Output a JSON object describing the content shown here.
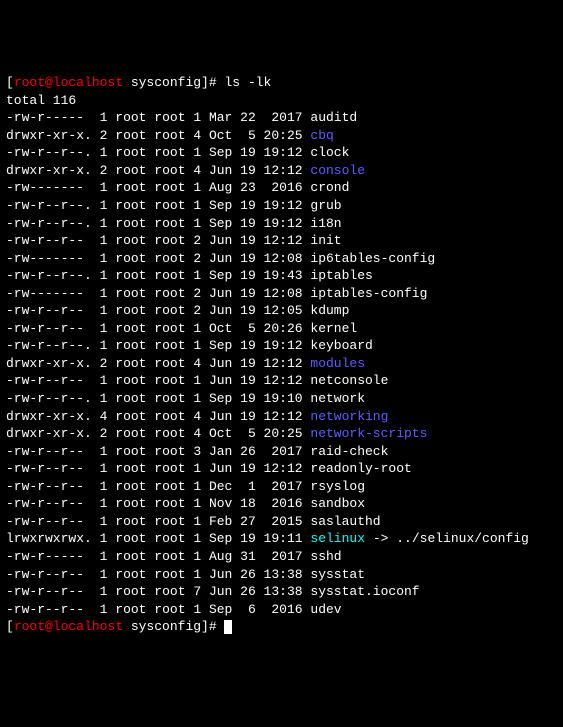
{
  "prompt": {
    "user": "root",
    "host": "localhost",
    "cwd": "sysconfig",
    "symbol": "#"
  },
  "command": "ls -lk",
  "total_line": "total 116",
  "rows": [
    {
      "perm": "-rw-r-----",
      "links": "1",
      "own": "root",
      "grp": "root",
      "size": "1",
      "date": "Mar 22  2017",
      "name": "auditd",
      "type": "file"
    },
    {
      "perm": "drwxr-xr-x.",
      "links": "2",
      "own": "root",
      "grp": "root",
      "size": "4",
      "date": "Oct  5 20:25",
      "name": "cbq",
      "type": "dir"
    },
    {
      "perm": "-rw-r--r--.",
      "links": "1",
      "own": "root",
      "grp": "root",
      "size": "1",
      "date": "Sep 19 19:12",
      "name": "clock",
      "type": "file"
    },
    {
      "perm": "drwxr-xr-x.",
      "links": "2",
      "own": "root",
      "grp": "root",
      "size": "4",
      "date": "Jun 19 12:12",
      "name": "console",
      "type": "dir"
    },
    {
      "perm": "-rw-------",
      "links": "1",
      "own": "root",
      "grp": "root",
      "size": "1",
      "date": "Aug 23  2016",
      "name": "crond",
      "type": "file"
    },
    {
      "perm": "-rw-r--r--.",
      "links": "1",
      "own": "root",
      "grp": "root",
      "size": "1",
      "date": "Sep 19 19:12",
      "name": "grub",
      "type": "file"
    },
    {
      "perm": "-rw-r--r--.",
      "links": "1",
      "own": "root",
      "grp": "root",
      "size": "1",
      "date": "Sep 19 19:12",
      "name": "i18n",
      "type": "file"
    },
    {
      "perm": "-rw-r--r--",
      "links": "1",
      "own": "root",
      "grp": "root",
      "size": "2",
      "date": "Jun 19 12:12",
      "name": "init",
      "type": "file"
    },
    {
      "perm": "-rw-------",
      "links": "1",
      "own": "root",
      "grp": "root",
      "size": "2",
      "date": "Jun 19 12:08",
      "name": "ip6tables-config",
      "type": "file"
    },
    {
      "perm": "-rw-r--r--.",
      "links": "1",
      "own": "root",
      "grp": "root",
      "size": "1",
      "date": "Sep 19 19:43",
      "name": "iptables",
      "type": "file"
    },
    {
      "perm": "-rw-------",
      "links": "1",
      "own": "root",
      "grp": "root",
      "size": "2",
      "date": "Jun 19 12:08",
      "name": "iptables-config",
      "type": "file"
    },
    {
      "perm": "-rw-r--r--",
      "links": "1",
      "own": "root",
      "grp": "root",
      "size": "2",
      "date": "Jun 19 12:05",
      "name": "kdump",
      "type": "file"
    },
    {
      "perm": "-rw-r--r--",
      "links": "1",
      "own": "root",
      "grp": "root",
      "size": "1",
      "date": "Oct  5 20:26",
      "name": "kernel",
      "type": "file"
    },
    {
      "perm": "-rw-r--r--.",
      "links": "1",
      "own": "root",
      "grp": "root",
      "size": "1",
      "date": "Sep 19 19:12",
      "name": "keyboard",
      "type": "file"
    },
    {
      "perm": "drwxr-xr-x.",
      "links": "2",
      "own": "root",
      "grp": "root",
      "size": "4",
      "date": "Jun 19 12:12",
      "name": "modules",
      "type": "dir"
    },
    {
      "perm": "-rw-r--r--",
      "links": "1",
      "own": "root",
      "grp": "root",
      "size": "1",
      "date": "Jun 19 12:12",
      "name": "netconsole",
      "type": "file"
    },
    {
      "perm": "-rw-r--r--.",
      "links": "1",
      "own": "root",
      "grp": "root",
      "size": "1",
      "date": "Sep 19 19:10",
      "name": "network",
      "type": "file"
    },
    {
      "perm": "drwxr-xr-x.",
      "links": "4",
      "own": "root",
      "grp": "root",
      "size": "4",
      "date": "Jun 19 12:12",
      "name": "networking",
      "type": "dir"
    },
    {
      "perm": "drwxr-xr-x.",
      "links": "2",
      "own": "root",
      "grp": "root",
      "size": "4",
      "date": "Oct  5 20:25",
      "name": "network-scripts",
      "type": "dir"
    },
    {
      "perm": "-rw-r--r--",
      "links": "1",
      "own": "root",
      "grp": "root",
      "size": "3",
      "date": "Jan 26  2017",
      "name": "raid-check",
      "type": "file"
    },
    {
      "perm": "-rw-r--r--",
      "links": "1",
      "own": "root",
      "grp": "root",
      "size": "1",
      "date": "Jun 19 12:12",
      "name": "readonly-root",
      "type": "file"
    },
    {
      "perm": "-rw-r--r--",
      "links": "1",
      "own": "root",
      "grp": "root",
      "size": "1",
      "date": "Dec  1  2017",
      "name": "rsyslog",
      "type": "file"
    },
    {
      "perm": "-rw-r--r--",
      "links": "1",
      "own": "root",
      "grp": "root",
      "size": "1",
      "date": "Nov 18  2016",
      "name": "sandbox",
      "type": "file"
    },
    {
      "perm": "-rw-r--r--",
      "links": "1",
      "own": "root",
      "grp": "root",
      "size": "1",
      "date": "Feb 27  2015",
      "name": "saslauthd",
      "type": "file"
    },
    {
      "perm": "lrwxrwxrwx.",
      "links": "1",
      "own": "root",
      "grp": "root",
      "size": "1",
      "date": "Sep 19 19:11",
      "name": "selinux",
      "type": "link",
      "arrow": "->",
      "target": "../selinux/config"
    },
    {
      "perm": "-rw-r-----",
      "links": "1",
      "own": "root",
      "grp": "root",
      "size": "1",
      "date": "Aug 31  2017",
      "name": "sshd",
      "type": "file"
    },
    {
      "perm": "-rw-r--r--",
      "links": "1",
      "own": "root",
      "grp": "root",
      "size": "1",
      "date": "Jun 26 13:38",
      "name": "sysstat",
      "type": "file"
    },
    {
      "perm": "-rw-r--r--",
      "links": "1",
      "own": "root",
      "grp": "root",
      "size": "7",
      "date": "Jun 26 13:38",
      "name": "sysstat.ioconf",
      "type": "file"
    },
    {
      "perm": "-rw-r--r--",
      "links": "1",
      "own": "root",
      "grp": "root",
      "size": "1",
      "date": "Sep  6  2016",
      "name": "udev",
      "type": "file"
    }
  ]
}
